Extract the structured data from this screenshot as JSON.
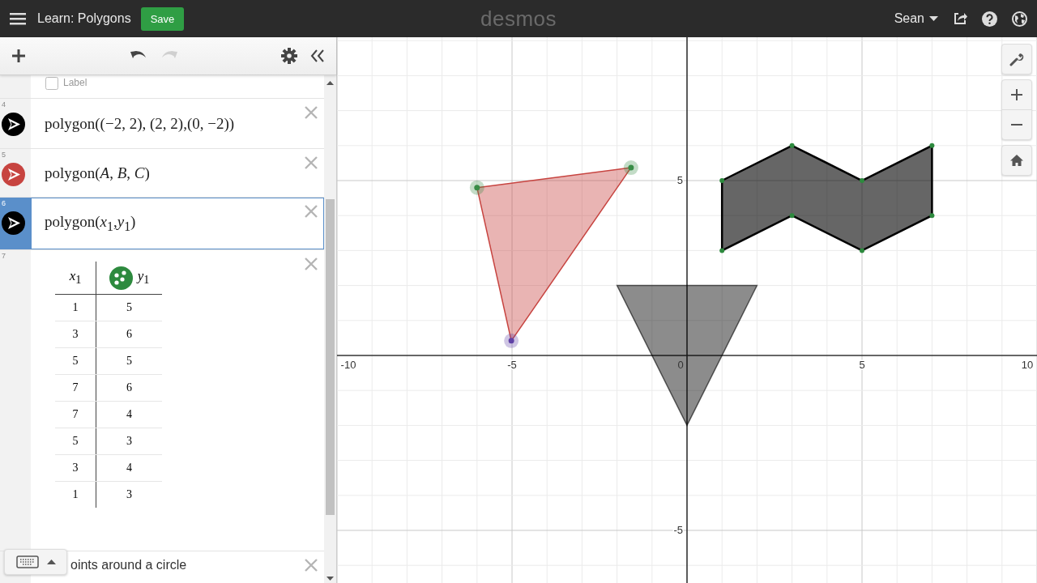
{
  "top_bar": {
    "title": "Learn: Polygons",
    "save_label": "Save",
    "logo": "desmos",
    "user": "Sean"
  },
  "label_option": {
    "label": "Label",
    "checked": false
  },
  "expressions": [
    {
      "kind": "math",
      "number": "4",
      "text": "polygon((−2, 2), (2, 2),(0, −2))",
      "color": "#000000",
      "selected": false
    },
    {
      "kind": "math",
      "number": "5",
      "text": "polygon(*A*, *B*, *C*)",
      "color": "#c74440",
      "selected": false
    },
    {
      "kind": "math",
      "number": "6",
      "text": "polygon(*x*$_{1}$,*y*$_{1}$)",
      "color": "#000000",
      "selected": true
    },
    {
      "kind": "table",
      "number": "7",
      "columns": [
        "*x*$_{1}$",
        "*y*$_{1}$"
      ],
      "color": "#2d8a3e",
      "selected": false,
      "rows": [
        [
          "1",
          "5"
        ],
        [
          "3",
          "6"
        ],
        [
          "5",
          "5"
        ],
        [
          "7",
          "6"
        ],
        [
          "7",
          "4"
        ],
        [
          "5",
          "3"
        ],
        [
          "3",
          "4"
        ],
        [
          "1",
          "3"
        ]
      ]
    },
    {
      "kind": "note",
      "text": "oints around a circle",
      "selected": false
    }
  ],
  "graph": {
    "x_labels": [
      "-10",
      "-5",
      "0",
      "5",
      "10"
    ],
    "y_labels": [
      "5",
      "-5"
    ]
  }
}
